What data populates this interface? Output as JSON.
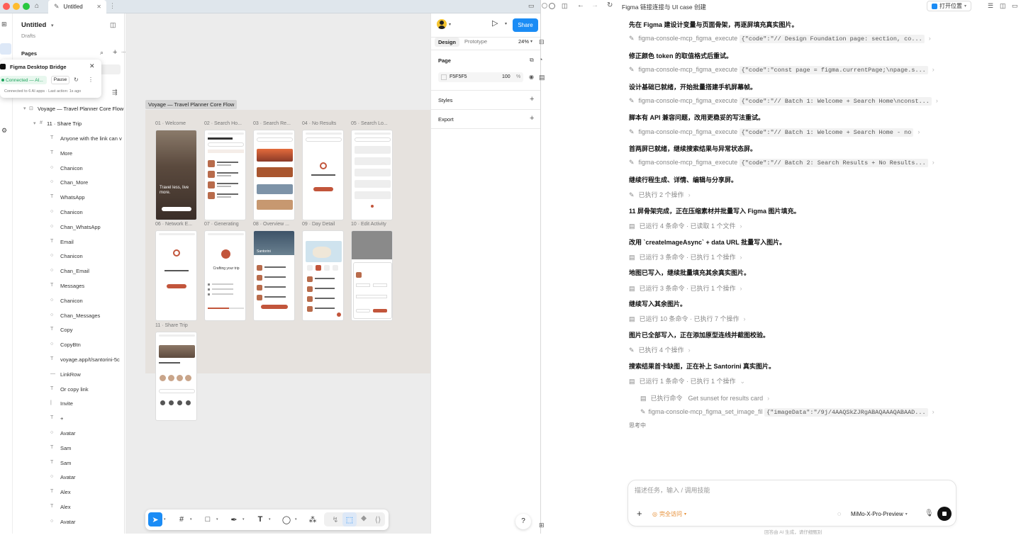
{
  "figma": {
    "tab_title": "Untitled",
    "file_name": "Untitled",
    "file_sub": "Drafts",
    "pages_label": "Pages",
    "bridge": {
      "title": "Figma Desktop Bridge",
      "status": "Connected — AI...",
      "pause": "Pause",
      "detail": "Connected to 6 AI apps · Last action: 1s ago"
    },
    "root_layer": "Voyage — Travel Planner Core Flow",
    "group_layer": "11 · Share Trip",
    "layers": [
      {
        "icon": "T",
        "label": "Anyone with the link can v"
      },
      {
        "icon": "T",
        "label": "More"
      },
      {
        "icon": "○",
        "label": "Chanicon"
      },
      {
        "icon": "○",
        "label": "Chan_More"
      },
      {
        "icon": "T",
        "label": "WhatsApp"
      },
      {
        "icon": "○",
        "label": "Chanicon"
      },
      {
        "icon": "○",
        "label": "Chan_WhatsApp"
      },
      {
        "icon": "T",
        "label": "Email"
      },
      {
        "icon": "○",
        "label": "Chanicon"
      },
      {
        "icon": "○",
        "label": "Chan_Email"
      },
      {
        "icon": "T",
        "label": "Messages"
      },
      {
        "icon": "○",
        "label": "Chanicon"
      },
      {
        "icon": "○",
        "label": "Chan_Messages"
      },
      {
        "icon": "T",
        "label": "Copy"
      },
      {
        "icon": "○",
        "label": "CopyBtn"
      },
      {
        "icon": "T",
        "label": "voyage.app/t/santorini-5c"
      },
      {
        "icon": "—",
        "label": "LinkRow"
      },
      {
        "icon": "T",
        "label": "Or copy link"
      },
      {
        "icon": "|",
        "label": "Invite"
      },
      {
        "icon": "T",
        "label": "+"
      },
      {
        "icon": "○",
        "label": "Avatar"
      },
      {
        "icon": "T",
        "label": "Sam"
      },
      {
        "icon": "T",
        "label": "Sam"
      },
      {
        "icon": "○",
        "label": "Avatar"
      },
      {
        "icon": "T",
        "label": "Alex"
      },
      {
        "icon": "T",
        "label": "Alex"
      },
      {
        "icon": "○",
        "label": "Avatar"
      }
    ],
    "canvas_frame_label": "Voyage — Travel Planner Core Flow",
    "screens": [
      {
        "label": "01 · Welcome"
      },
      {
        "label": "02 · Search Ho..."
      },
      {
        "label": "03 · Search Re..."
      },
      {
        "label": "04 · No Results"
      },
      {
        "label": "05 · Search Lo..."
      },
      {
        "label": "06 · Network E..."
      },
      {
        "label": "07 · Generating"
      },
      {
        "label": "08 · Overview ..."
      },
      {
        "label": "09 · Day Detail"
      },
      {
        "label": "10 · Edit Activity"
      },
      {
        "label": "11 · Share Trip"
      }
    ],
    "welcome_tagline": "Travel less, live more.",
    "generating_text": "Crafting your trip",
    "santorini_text": "Santorini",
    "right": {
      "share_label": "Share",
      "design_tab": "Design",
      "prototype_tab": "Prototype",
      "zoom": "24%",
      "page_label": "Page",
      "fill_hex": "F5F5F5",
      "fill_opacity": "100",
      "fill_pct": "%",
      "styles_label": "Styles",
      "export_label": "Export"
    }
  },
  "chat": {
    "title": "Figma 链接连接与 UI case 创建",
    "open_location": "打开位置",
    "messages": [
      {
        "kind": "text",
        "text": "先在 Figma 建设计变量与页面骨架，再逐屏填充真实图片。"
      },
      {
        "kind": "tool",
        "name": "figma-console-mcp_figma_execute",
        "code": "{\"code\":\"// Design Foundation page: section, co..."
      },
      {
        "kind": "text",
        "text": "修正颜色 token 的取值格式后重试。"
      },
      {
        "kind": "tool",
        "name": "figma-console-mcp_figma_execute",
        "code": "{\"code\":\"const page = figma.currentPage;\\npage.s..."
      },
      {
        "kind": "text",
        "text": "设计基础已就绪，开始批量搭建手机屏幕帧。"
      },
      {
        "kind": "tool",
        "name": "figma-console-mcp_figma_execute",
        "code": "{\"code\":\"// Batch 1: Welcome + Search Home\\nconst..."
      },
      {
        "kind": "text",
        "text": "脚本有 API 兼容问题，改用更稳妥的写法重试。"
      },
      {
        "kind": "tool",
        "name": "figma-console-mcp_figma_execute",
        "code": "{\"code\":\"// Batch 1: Welcome + Search Home - no"
      },
      {
        "kind": "text",
        "text": "首两屏已就绪，继续搜索结果与异常状态屏。"
      },
      {
        "kind": "tool",
        "name": "figma-console-mcp_figma_execute",
        "code": "{\"code\":\"// Batch 2: Search Results + No Results..."
      },
      {
        "kind": "text",
        "text": "继续行程生成、详情、编辑与分享屏。"
      },
      {
        "kind": "summary",
        "icon": "tool",
        "text": "已执行 2 个操作"
      },
      {
        "kind": "text",
        "text": "11 屏骨架完成，正在压缩素材并批量写入 Figma 图片填充。"
      },
      {
        "kind": "summary",
        "icon": "term",
        "text": "已运行 4 条命令 · 已读取 1 个文件"
      },
      {
        "kind": "text",
        "text": "改用 `createImageAsync` + data URL 批量写入图片。"
      },
      {
        "kind": "summary",
        "icon": "term",
        "text": "已运行 3 条命令 · 已执行 1 个操作"
      },
      {
        "kind": "text",
        "text": "地图已写入，继续批量填充其余真实图片。"
      },
      {
        "kind": "summary",
        "icon": "term",
        "text": "已运行 3 条命令 · 已执行 1 个操作"
      },
      {
        "kind": "text",
        "text": "继续写入其余图片。"
      },
      {
        "kind": "summary",
        "icon": "term",
        "text": "已运行 10 条命令 · 已执行 7 个操作"
      },
      {
        "kind": "text",
        "text": "图片已全部写入，正在添加原型连线并截图校验。"
      },
      {
        "kind": "summary",
        "icon": "tool",
        "text": "已执行 4 个操作"
      },
      {
        "kind": "text",
        "text": "搜索结果首卡缺图，正在补上 Santorini 真实图片。"
      },
      {
        "kind": "summary",
        "icon": "term",
        "text": "已运行 1 条命令 · 已执行 1 个操作",
        "expanded": true
      }
    ],
    "sub_items": [
      {
        "icon": "term",
        "label": "已执行命令",
        "detail": "Get sunset for results card"
      },
      {
        "icon": "tool",
        "label": "figma-console-mcp_figma_set_image_fil",
        "code": "{\"imageData\":\"/9j/4AAQSkZJRgABAQAAAQABAAD..."
      }
    ],
    "thinking": "思考中",
    "input_placeholder": "描述任务，输入 / 调用技能",
    "permission": "完全访问",
    "model": "MiMo-X-Pro-Preview",
    "footer": "回答由 AI 生成，请仔细甄别"
  },
  "colors": {
    "accent": "#1b8cf5",
    "terracotta": "#c2553b",
    "connected": "#1aa35b"
  }
}
